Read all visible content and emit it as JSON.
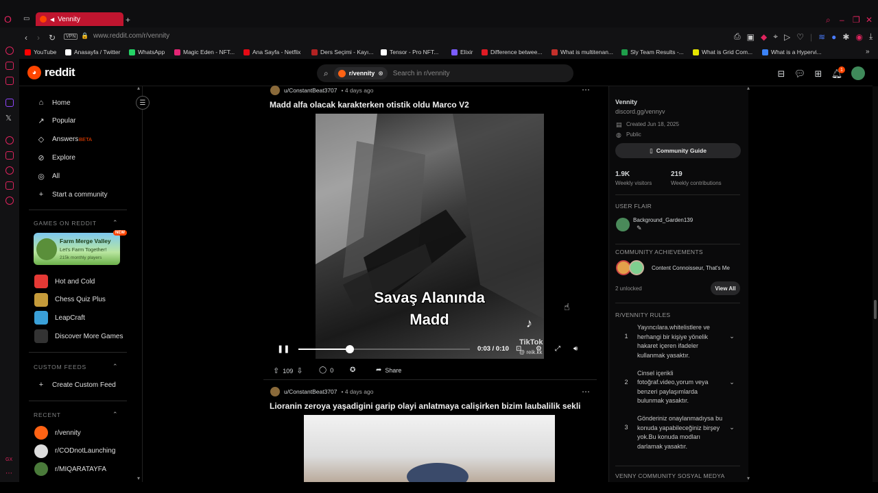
{
  "browser": {
    "tab_title": "Vennity",
    "url": "www.reddit.com/r/vennity",
    "vpn": "VPN",
    "bookmarks": [
      {
        "label": "YouTube",
        "color": "#ff0000"
      },
      {
        "label": "Anasayfa / Twitter",
        "color": "#ffffff"
      },
      {
        "label": "WhatsApp",
        "color": "#25d366"
      },
      {
        "label": "Magic Eden - NFT...",
        "color": "#e42575"
      },
      {
        "label": "Ana Sayfa - Netflix",
        "color": "#e50914"
      },
      {
        "label": "Ders Seçimi - Kayı...",
        "color": "#b22222"
      },
      {
        "label": "Tensor - Pro NFT...",
        "color": "#ffffff"
      },
      {
        "label": "Elixir",
        "color": "#7b5cff"
      },
      {
        "label": "Difference betwee...",
        "color": "#e01b24"
      },
      {
        "label": "What is multitenan...",
        "color": "#c4302b"
      },
      {
        "label": "Sly Team Results -...",
        "color": "#1e9e4a"
      },
      {
        "label": "What is Grid Com...",
        "color": "#e6e600"
      },
      {
        "label": "What is a Hypervi...",
        "color": "#3b82f6"
      }
    ]
  },
  "reddit": {
    "logo_text": "reddit",
    "search_chip": "r/vennity",
    "search_placeholder": "Search in r/vennity",
    "notification_count": "1"
  },
  "nav": {
    "items": [
      {
        "label": "Home",
        "icon": "home-icon",
        "glyph": "⌂"
      },
      {
        "label": "Popular",
        "icon": "popular-icon",
        "glyph": "↗"
      },
      {
        "label": "Answers",
        "icon": "answers-icon",
        "glyph": "◇"
      },
      {
        "label": "Explore",
        "icon": "explore-icon",
        "glyph": "⊘"
      },
      {
        "label": "All",
        "icon": "all-icon",
        "glyph": "◎"
      },
      {
        "label": "Start a community",
        "icon": "plus-icon",
        "glyph": "+"
      }
    ],
    "answers_badge": "BETA",
    "games_header": "GAMES ON REDDIT",
    "featured_game": {
      "title": "Farm Merge Valley",
      "subtitle": "Let's Farm Together!",
      "players": "215k monthly players",
      "badge": "NEW"
    },
    "games": [
      {
        "label": "Hot and Cold",
        "color": "#e53935"
      },
      {
        "label": "Chess Quiz Plus",
        "color": "#c59b3a"
      },
      {
        "label": "LeapCraft",
        "color": "#3aa0d8"
      },
      {
        "label": "Discover More Games",
        "color": "#333333"
      }
    ],
    "custom_feeds_header": "CUSTOM FEEDS",
    "create_custom_feed": "Create Custom Feed",
    "recent_header": "RECENT",
    "recent": [
      {
        "label": "r/vennity",
        "color": "#ff6314"
      },
      {
        "label": "r/CODnotLaunching",
        "color": "#dddddd"
      },
      {
        "label": "r/MIQARATAYFA",
        "color": "#4a7a3a"
      }
    ]
  },
  "posts": [
    {
      "author": "u/ConstantBeat3707",
      "age": "• 4 days ago",
      "title": "Madd alfa olacak karakterken otistik oldu Marco V2",
      "overlay_line1": "Savaş Alanında",
      "overlay_line2": "Madd",
      "watermark": "TikTok",
      "watermark_user": "@ reik.kk",
      "time": "0:03 / 0:10",
      "progress": 0.3,
      "upvotes": "109",
      "comments": "0",
      "share": "Share"
    },
    {
      "author": "u/ConstantBeat3707",
      "age": "• 4 days ago",
      "title": "Lioranin zeroya yaşadigini garip olayi anlatmaya calişirken bizim laubalilik sekli"
    }
  ],
  "sidebar": {
    "name": "Vennity",
    "link": "discord.gg/vennyv",
    "created": "Created Jun 18, 2025",
    "visibility": "Public",
    "guide_button": "Community Guide",
    "visitors_value": "1.9K",
    "visitors_label": "Weekly visitors",
    "contrib_value": "219",
    "contrib_label": "Weekly contributions",
    "user_flair_header": "USER FLAIR",
    "user_flair_name": "Background_Garden139",
    "achievements_header": "COMMUNITY ACHIEVEMENTS",
    "achievements_text": "Content Connoisseur, That's Me",
    "unlocked": "2 unlocked",
    "view_all": "View All",
    "rules_header": "R/VENNITY RULES",
    "rules": [
      {
        "n": "1",
        "text": "Yayıncılara.whitelistlere ve herhangi bir kişiye yönelik hakaret içeren ifadeler kullanmak yasaktır."
      },
      {
        "n": "2",
        "text": "Cinsel içerikli fotoğraf.video,yorum veya benzeri paylaşımlarda bulunmak yasaktır."
      },
      {
        "n": "3",
        "text": "Gönderiniz onaylanmadıysa bu konuda yapabileceğiniz birşey yok.Bu konuda modları darlamak yasaktır."
      }
    ],
    "social_header": "VENNY COMMUNITY SOSYAL MEDYA"
  }
}
